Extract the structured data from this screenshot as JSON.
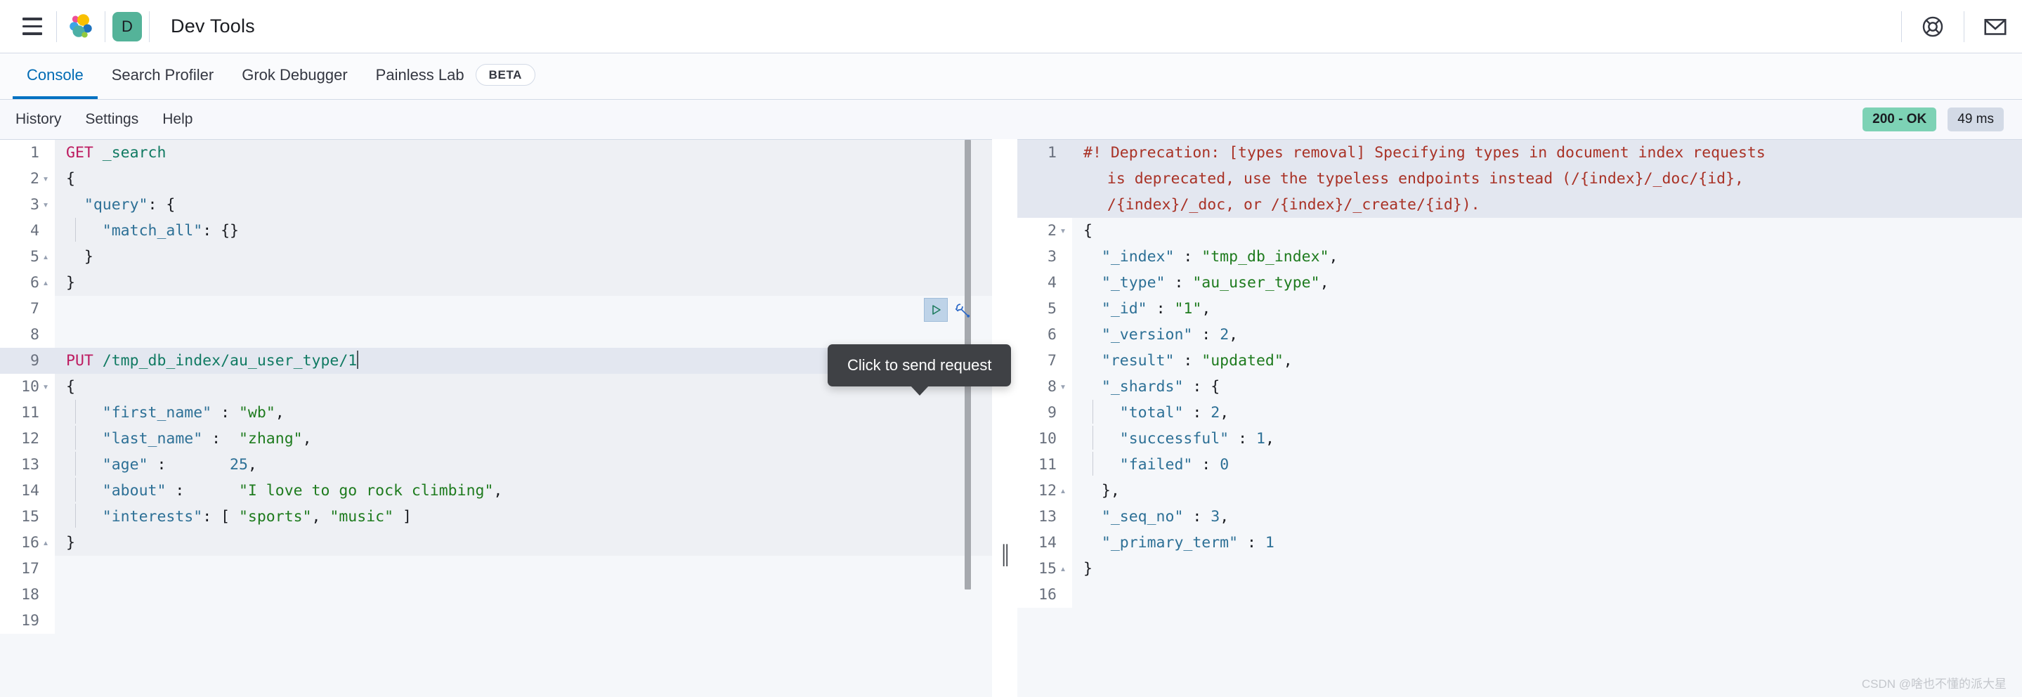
{
  "header": {
    "menu_icon": "hamburger-menu-icon",
    "logo_icon": "elastic-logo-icon",
    "space_badge": "D",
    "app_title": "Dev Tools",
    "help_icon": "lifebuoy-help-icon",
    "mail_icon": "envelope-mail-icon"
  },
  "tabs": [
    {
      "label": "Console",
      "active": true
    },
    {
      "label": "Search Profiler",
      "active": false
    },
    {
      "label": "Grok Debugger",
      "active": false
    },
    {
      "label": "Painless Lab",
      "active": false,
      "badge": "BETA"
    }
  ],
  "toolbar": {
    "history_label": "History",
    "settings_label": "Settings",
    "help_label": "Help",
    "status_code": "200 - OK",
    "elapsed": "49 ms"
  },
  "actions": {
    "send_tooltip": "Click to send request",
    "play_icon": "play-triangle-icon",
    "wrench_icon": "wrench-icon"
  },
  "colors": {
    "accent": "#0071c2",
    "space_badge_bg": "#54b399",
    "status_ok_bg": "#7dd2b5",
    "time_badge_bg": "#d3dae6",
    "method": "#bd1b60",
    "url": "#107a62",
    "key": "#2d7096",
    "string": "#1e7b1e",
    "warning": "#a93226",
    "active_line": "#e3e7f0"
  },
  "editor": {
    "lines": [
      {
        "n": "1",
        "fold": "",
        "active": false,
        "indent": 0,
        "tokens": [
          {
            "t": "method",
            "v": "GET"
          },
          {
            "t": "punc",
            "v": " "
          },
          {
            "t": "url",
            "v": "_search"
          }
        ]
      },
      {
        "n": "2",
        "fold": "▾",
        "active": false,
        "indent": 0,
        "tokens": [
          {
            "t": "punc",
            "v": "{"
          }
        ]
      },
      {
        "n": "3",
        "fold": "▾",
        "active": false,
        "indent": 0,
        "tokens": [
          {
            "t": "punc",
            "v": "  "
          },
          {
            "t": "key",
            "v": "\"query\""
          },
          {
            "t": "punc",
            "v": ": {"
          }
        ]
      },
      {
        "n": "4",
        "fold": "",
        "active": false,
        "indent": 1,
        "tokens": [
          {
            "t": "punc",
            "v": "   "
          },
          {
            "t": "key",
            "v": "\"match_all\""
          },
          {
            "t": "punc",
            "v": ": {}"
          }
        ]
      },
      {
        "n": "5",
        "fold": "▴",
        "active": false,
        "indent": 0,
        "tokens": [
          {
            "t": "punc",
            "v": "  }"
          }
        ]
      },
      {
        "n": "6",
        "fold": "▴",
        "active": false,
        "indent": 0,
        "tokens": [
          {
            "t": "punc",
            "v": "}"
          }
        ]
      },
      {
        "n": "7",
        "fold": "",
        "active": false,
        "indent": 0,
        "blank": true,
        "tokens": []
      },
      {
        "n": "8",
        "fold": "",
        "active": false,
        "indent": 0,
        "blank": true,
        "tokens": []
      },
      {
        "n": "9",
        "fold": "",
        "active": true,
        "indent": 0,
        "caret": true,
        "tokens": [
          {
            "t": "method",
            "v": "PUT"
          },
          {
            "t": "punc",
            "v": " "
          },
          {
            "t": "url",
            "v": "/tmp_db_index/au_user_type/1"
          }
        ]
      },
      {
        "n": "10",
        "fold": "▾",
        "active": false,
        "indent": 0,
        "tokens": [
          {
            "t": "punc",
            "v": "{"
          }
        ]
      },
      {
        "n": "11",
        "fold": "",
        "active": false,
        "indent": 1,
        "tokens": [
          {
            "t": "punc",
            "v": "   "
          },
          {
            "t": "key",
            "v": "\"first_name\""
          },
          {
            "t": "punc",
            "v": " : "
          },
          {
            "t": "str",
            "v": "\"wb\""
          },
          {
            "t": "punc",
            "v": ","
          }
        ]
      },
      {
        "n": "12",
        "fold": "",
        "active": false,
        "indent": 1,
        "tokens": [
          {
            "t": "punc",
            "v": "   "
          },
          {
            "t": "key",
            "v": "\"last_name\""
          },
          {
            "t": "punc",
            "v": " :  "
          },
          {
            "t": "str",
            "v": "\"zhang\""
          },
          {
            "t": "punc",
            "v": ","
          }
        ]
      },
      {
        "n": "13",
        "fold": "",
        "active": false,
        "indent": 1,
        "tokens": [
          {
            "t": "punc",
            "v": "   "
          },
          {
            "t": "key",
            "v": "\"age\""
          },
          {
            "t": "punc",
            "v": " :       "
          },
          {
            "t": "num",
            "v": "25"
          },
          {
            "t": "punc",
            "v": ","
          }
        ]
      },
      {
        "n": "14",
        "fold": "",
        "active": false,
        "indent": 1,
        "tokens": [
          {
            "t": "punc",
            "v": "   "
          },
          {
            "t": "key",
            "v": "\"about\""
          },
          {
            "t": "punc",
            "v": " :      "
          },
          {
            "t": "str",
            "v": "\"I love to go rock climbing\""
          },
          {
            "t": "punc",
            "v": ","
          }
        ]
      },
      {
        "n": "15",
        "fold": "",
        "active": false,
        "indent": 1,
        "tokens": [
          {
            "t": "punc",
            "v": "   "
          },
          {
            "t": "key",
            "v": "\"interests\""
          },
          {
            "t": "punc",
            "v": ": [ "
          },
          {
            "t": "str",
            "v": "\"sports\""
          },
          {
            "t": "punc",
            "v": ", "
          },
          {
            "t": "str",
            "v": "\"music\""
          },
          {
            "t": "punc",
            "v": " ]"
          }
        ]
      },
      {
        "n": "16",
        "fold": "▴",
        "active": false,
        "indent": 0,
        "tokens": [
          {
            "t": "punc",
            "v": "}"
          }
        ]
      },
      {
        "n": "17",
        "fold": "",
        "active": false,
        "indent": 0,
        "blank": true,
        "tokens": []
      },
      {
        "n": "18",
        "fold": "",
        "active": false,
        "indent": 0,
        "blank": true,
        "tokens": []
      },
      {
        "n": "19",
        "fold": "",
        "active": false,
        "indent": 0,
        "blank": true,
        "tokens": []
      }
    ]
  },
  "response": {
    "lines": [
      {
        "n": "1",
        "fold": "",
        "active": true,
        "indent": 0,
        "wrapped": [
          "#! Deprecation: [types removal] Specifying types in document index requests",
          "is deprecated, use the typeless endpoints instead (/{index}/_doc/{id},",
          "/{index}/_doc, or /{index}/_create/{id})."
        ],
        "tokens": []
      },
      {
        "n": "2",
        "fold": "▾",
        "active": false,
        "indent": 0,
        "tokens": [
          {
            "t": "punc",
            "v": "{"
          }
        ]
      },
      {
        "n": "3",
        "fold": "",
        "active": false,
        "indent": 0,
        "tokens": [
          {
            "t": "punc",
            "v": "  "
          },
          {
            "t": "key",
            "v": "\"_index\""
          },
          {
            "t": "punc",
            "v": " : "
          },
          {
            "t": "str",
            "v": "\"tmp_db_index\""
          },
          {
            "t": "punc",
            "v": ","
          }
        ]
      },
      {
        "n": "4",
        "fold": "",
        "active": false,
        "indent": 0,
        "tokens": [
          {
            "t": "punc",
            "v": "  "
          },
          {
            "t": "key",
            "v": "\"_type\""
          },
          {
            "t": "punc",
            "v": " : "
          },
          {
            "t": "str",
            "v": "\"au_user_type\""
          },
          {
            "t": "punc",
            "v": ","
          }
        ]
      },
      {
        "n": "5",
        "fold": "",
        "active": false,
        "indent": 0,
        "tokens": [
          {
            "t": "punc",
            "v": "  "
          },
          {
            "t": "key",
            "v": "\"_id\""
          },
          {
            "t": "punc",
            "v": " : "
          },
          {
            "t": "str",
            "v": "\"1\""
          },
          {
            "t": "punc",
            "v": ","
          }
        ]
      },
      {
        "n": "6",
        "fold": "",
        "active": false,
        "indent": 0,
        "tokens": [
          {
            "t": "punc",
            "v": "  "
          },
          {
            "t": "key",
            "v": "\"_version\""
          },
          {
            "t": "punc",
            "v": " : "
          },
          {
            "t": "num",
            "v": "2"
          },
          {
            "t": "punc",
            "v": ","
          }
        ]
      },
      {
        "n": "7",
        "fold": "",
        "active": false,
        "indent": 0,
        "tokens": [
          {
            "t": "punc",
            "v": "  "
          },
          {
            "t": "key",
            "v": "\"result\""
          },
          {
            "t": "punc",
            "v": " : "
          },
          {
            "t": "str",
            "v": "\"updated\""
          },
          {
            "t": "punc",
            "v": ","
          }
        ]
      },
      {
        "n": "8",
        "fold": "▾",
        "active": false,
        "indent": 0,
        "tokens": [
          {
            "t": "punc",
            "v": "  "
          },
          {
            "t": "key",
            "v": "\"_shards\""
          },
          {
            "t": "punc",
            "v": " : {"
          }
        ]
      },
      {
        "n": "9",
        "fold": "",
        "active": false,
        "indent": 1,
        "tokens": [
          {
            "t": "punc",
            "v": "   "
          },
          {
            "t": "key",
            "v": "\"total\""
          },
          {
            "t": "punc",
            "v": " : "
          },
          {
            "t": "num",
            "v": "2"
          },
          {
            "t": "punc",
            "v": ","
          }
        ]
      },
      {
        "n": "10",
        "fold": "",
        "active": false,
        "indent": 1,
        "tokens": [
          {
            "t": "punc",
            "v": "   "
          },
          {
            "t": "key",
            "v": "\"successful\""
          },
          {
            "t": "punc",
            "v": " : "
          },
          {
            "t": "num",
            "v": "1"
          },
          {
            "t": "punc",
            "v": ","
          }
        ]
      },
      {
        "n": "11",
        "fold": "",
        "active": false,
        "indent": 1,
        "tokens": [
          {
            "t": "punc",
            "v": "   "
          },
          {
            "t": "key",
            "v": "\"failed\""
          },
          {
            "t": "punc",
            "v": " : "
          },
          {
            "t": "num",
            "v": "0"
          }
        ]
      },
      {
        "n": "12",
        "fold": "▴",
        "active": false,
        "indent": 0,
        "tokens": [
          {
            "t": "punc",
            "v": "  },"
          }
        ]
      },
      {
        "n": "13",
        "fold": "",
        "active": false,
        "indent": 0,
        "tokens": [
          {
            "t": "punc",
            "v": "  "
          },
          {
            "t": "key",
            "v": "\"_seq_no\""
          },
          {
            "t": "punc",
            "v": " : "
          },
          {
            "t": "num",
            "v": "3"
          },
          {
            "t": "punc",
            "v": ","
          }
        ]
      },
      {
        "n": "14",
        "fold": "",
        "active": false,
        "indent": 0,
        "tokens": [
          {
            "t": "punc",
            "v": "  "
          },
          {
            "t": "key",
            "v": "\"_primary_term\""
          },
          {
            "t": "punc",
            "v": " : "
          },
          {
            "t": "num",
            "v": "1"
          }
        ]
      },
      {
        "n": "15",
        "fold": "▴",
        "active": false,
        "indent": 0,
        "tokens": [
          {
            "t": "punc",
            "v": "}"
          }
        ]
      },
      {
        "n": "16",
        "fold": "",
        "active": false,
        "indent": 0,
        "blank": true,
        "tokens": []
      }
    ]
  },
  "watermark": "CSDN @啥也不懂的派大星"
}
